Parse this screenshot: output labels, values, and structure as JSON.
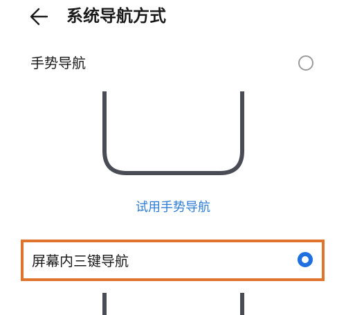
{
  "header": {
    "title": "系统导航方式",
    "back_icon": "arrow-left-icon"
  },
  "options": {
    "gesture": {
      "label": "手势导航",
      "selected": false,
      "try_link": "试用手势导航"
    },
    "three_key": {
      "label": "屏幕内三键导航",
      "selected": true
    }
  },
  "colors": {
    "accent": "#1f6fe0",
    "link": "#2b7bd4",
    "highlight": "#e0742c",
    "phone_outline": "#4a4c55"
  }
}
